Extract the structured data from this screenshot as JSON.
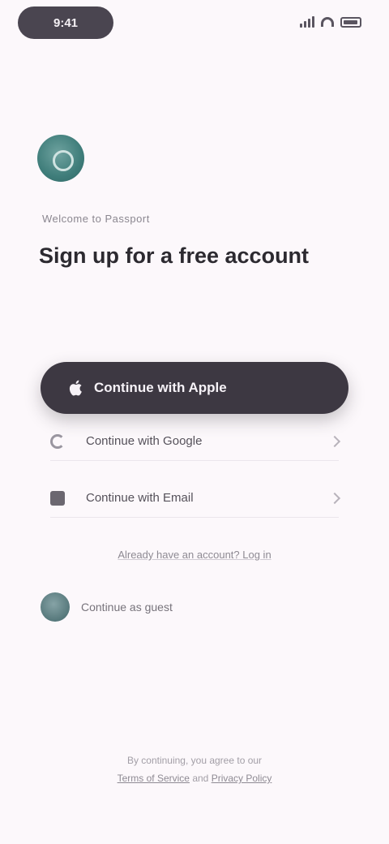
{
  "status_bar": {
    "time": "9:41",
    "signal_icon": "cellular-signal-icon",
    "wifi_icon": "wifi-icon",
    "battery_icon": "battery-icon"
  },
  "brand": {
    "logo_icon": "brand-logo-icon",
    "accent_color": "#3f7d7a"
  },
  "header": {
    "eyebrow": "Welcome to Passport",
    "title": "Sign up for a free account"
  },
  "auth": {
    "primary_label": "Continue with Apple",
    "primary_icon": "apple-icon",
    "primary_color": "#3d3842",
    "options": [
      {
        "label": "Continue with Google",
        "icon": "google-icon"
      },
      {
        "label": "Continue with Email",
        "icon": "mail-icon"
      }
    ],
    "alt_link": "Already have an account? Log in"
  },
  "guest": {
    "label": "Continue as guest",
    "avatar_icon": "guest-avatar-icon"
  },
  "legal": {
    "prefix": "By continuing, you agree to our",
    "terms": "Terms of Service",
    "joiner": "and",
    "privacy": "Privacy Policy"
  }
}
